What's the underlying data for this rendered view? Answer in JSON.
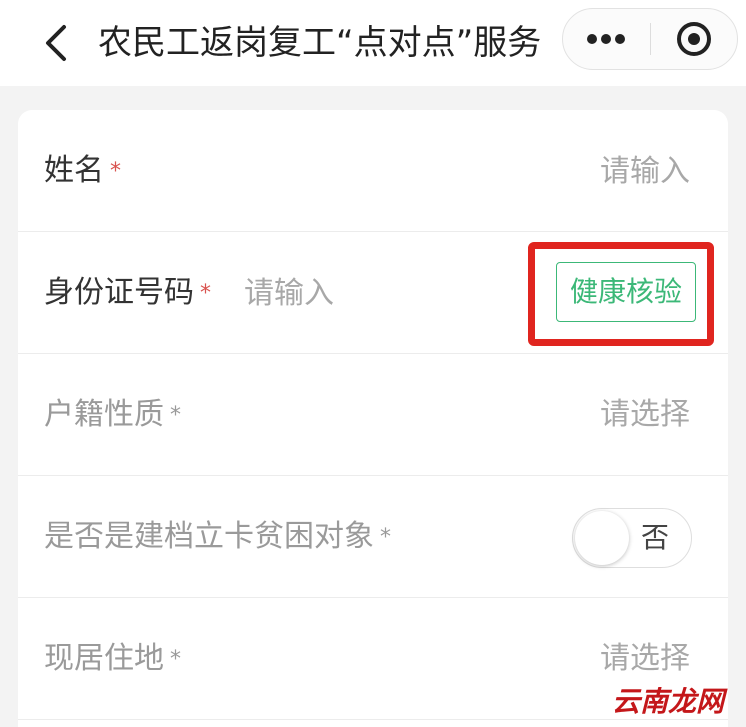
{
  "navbar": {
    "title": "农民工返岗复工“点对点”服务",
    "back_icon": "chevron-left-icon",
    "more_icon": "more-dots-icon",
    "close_icon": "target-close-icon"
  },
  "form": {
    "name": {
      "label": "姓名",
      "required_mark": "*",
      "placeholder": "请输入"
    },
    "id_number": {
      "label": "身份证号码",
      "required_mark": "*",
      "placeholder": "请输入",
      "verify_button": "健康核验"
    },
    "household_type": {
      "label": "户籍性质",
      "required_mark": "*",
      "value": "请选择"
    },
    "poverty_target": {
      "label": "是否是建档立卡贫困对象",
      "required_mark": "*",
      "toggle_text": "否",
      "checked": false
    },
    "residence": {
      "label": "现居住地",
      "required_mark": "*",
      "value": "请选择"
    }
  },
  "colors": {
    "accent_green": "#3cb878",
    "required_red": "#d9534f",
    "highlight_red": "#e0251f"
  },
  "watermark": "云南龙网"
}
